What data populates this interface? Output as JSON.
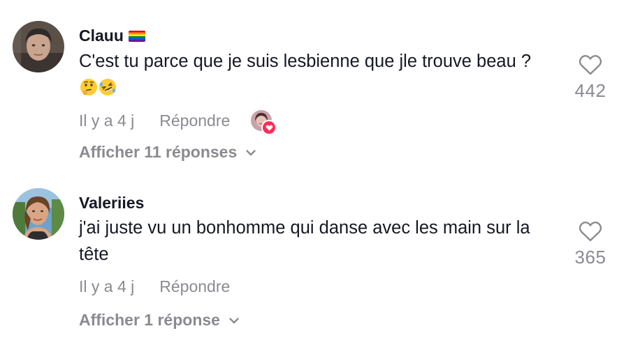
{
  "comments": [
    {
      "username": "Clauu",
      "username_badge_icon": "rainbow-flag-icon",
      "text": "C'est tu parce que je suis lesbienne que jle trouve beau ?",
      "emojis": [
        "thinking-face-icon",
        "rolling-laughing-icon"
      ],
      "time": "Il y a 4 j",
      "reply_label": "Répondre",
      "liked_by_creator": true,
      "likes": "442",
      "view_replies": "Afficher 11 réponses"
    },
    {
      "username": "Valeriies",
      "text": "j'ai juste vu un bonhomme qui danse avec les main sur la tête",
      "time": "Il y a 4 j",
      "reply_label": "Répondre",
      "liked_by_creator": false,
      "likes": "365",
      "view_replies": "Afficher 1 réponse"
    }
  ],
  "colors": {
    "text": "#161823",
    "muted": "#8a8b91",
    "like_badge": "#fe2c55"
  }
}
